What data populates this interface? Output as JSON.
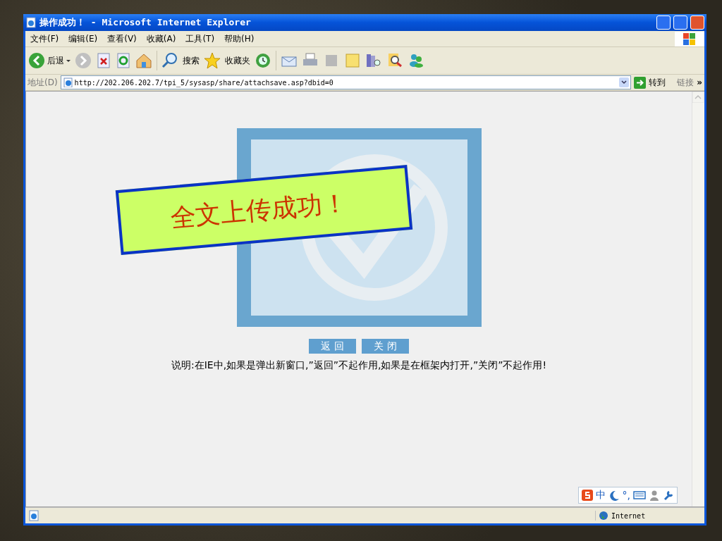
{
  "window": {
    "title": "操作成功！ - Microsoft Internet Explorer"
  },
  "menu": [
    "文件(F)",
    "编辑(E)",
    "查看(V)",
    "收藏(A)",
    "工具(T)",
    "帮助(H)"
  ],
  "toolbar": {
    "back": "后退",
    "search": "搜索",
    "favorites": "收藏夹"
  },
  "address_bar": {
    "label": "地址(D)",
    "url": "http://202.206.202.7/tpi_5/sysasp/share/attachsave.asp?dbid=0",
    "go": "转到",
    "links": "链接",
    "more": "»"
  },
  "page": {
    "banner": "全文上传成功！",
    "buttons": [
      "返 回",
      "关 闭"
    ],
    "note": "说明:在IE中,如果是弹出新窗口,”返回”不起作用,如果是在框架内打开,”关闭”不起作用!"
  },
  "ime_bar": {
    "mode": "中",
    "punctuation": "°,"
  },
  "status_bar": {
    "zone": "Internet"
  }
}
